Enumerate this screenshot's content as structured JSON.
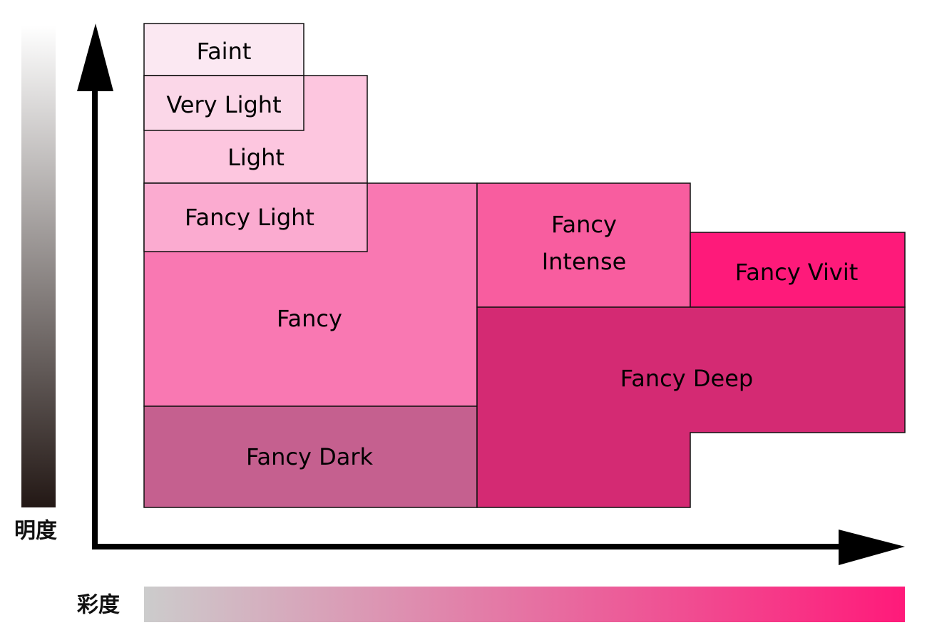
{
  "axes": {
    "vertical_label": "明度",
    "horizontal_label": "彩度",
    "vertical_gradient": [
      "#ffffff",
      "#231815"
    ],
    "horizontal_gradient": [
      "#cccccc",
      "#ff1a7a"
    ]
  },
  "grades": {
    "faint": {
      "label": "Faint",
      "color": "#fbe8f2"
    },
    "very_light": {
      "label": "Very Light",
      "color": "#fbd7e8"
    },
    "light": {
      "label": "Light",
      "color": "#fdc6df"
    },
    "fancy_light": {
      "label": "Fancy Light",
      "color": "#fbabd0"
    },
    "fancy": {
      "label": "Fancy",
      "color": "#f978b2"
    },
    "fancy_dark": {
      "label": "Fancy Dark",
      "color": "#c5608f"
    },
    "fancy_intense": {
      "label_line1": "Fancy",
      "label_line2": "Intense",
      "color": "#f85d9f"
    },
    "fancy_vivid": {
      "label": "Fancy Vivit",
      "color": "#fe1a7a"
    },
    "fancy_deep": {
      "label": "Fancy Deep",
      "color": "#d42a73"
    }
  }
}
